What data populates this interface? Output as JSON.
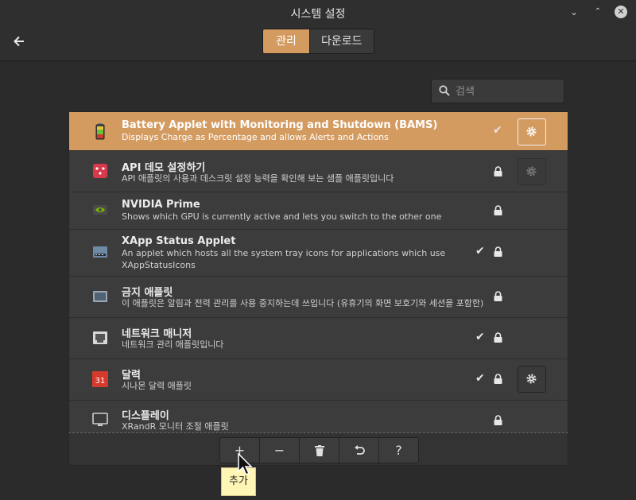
{
  "window": {
    "title": "시스템 설정"
  },
  "window_controls": {
    "minimize": "⌄",
    "maximize": "⌃",
    "close": "✕"
  },
  "header": {
    "back_icon": "back-arrow-icon",
    "tabs": [
      {
        "label": "관리",
        "active": true
      },
      {
        "label": "다운로드",
        "active": false
      }
    ]
  },
  "search": {
    "placeholder": "검색",
    "value": ""
  },
  "applets": [
    {
      "name": "Battery  Applet with Monitoring and Shutdown (BAMS)",
      "desc": "Displays Charge as Percentage and allows Alerts and Actions",
      "icon": "battery-icon",
      "enabled": true,
      "locked": false,
      "configurable": true,
      "selected": true
    },
    {
      "name": "API 데모 설정하기",
      "desc": "API 애플릿의 사용과 데스크릿 설정 능력을 확인해 보는 샘플 애플릿입니다",
      "icon": "api-demo-icon",
      "enabled": false,
      "locked": true,
      "configurable": true,
      "selected": false
    },
    {
      "name": "NVIDIA Prime",
      "desc": "Shows which GPU is currently active and lets you switch to the other one",
      "icon": "nvidia-icon",
      "enabled": false,
      "locked": true,
      "configurable": false,
      "selected": false
    },
    {
      "name": "XApp Status Applet",
      "desc": "An applet which hosts all the system tray icons for applications which use",
      "desc2": "XAppStatusIcons",
      "icon": "status-tray-icon",
      "enabled": true,
      "locked": true,
      "configurable": false,
      "selected": false
    },
    {
      "name": "금지 애플릿",
      "desc": "이 애플릿은 알림과 전력 관리를 사용 중지하는데 쓰입니다 (유휴기의 화면 보호기와 세션을 포함한)",
      "icon": "inhibit-icon",
      "enabled": false,
      "locked": true,
      "configurable": false,
      "selected": false
    },
    {
      "name": "네트워크 매니저",
      "desc": "네트워크 관리 애플릿입니다",
      "icon": "network-icon",
      "enabled": true,
      "locked": true,
      "configurable": false,
      "selected": false
    },
    {
      "name": "달력",
      "desc": "시나몬 달력 애플릿",
      "icon": "calendar-icon",
      "calendar_day": "31",
      "enabled": true,
      "locked": true,
      "configurable": true,
      "selected": false
    },
    {
      "name": "디스플레이",
      "desc": "XRandR 모니터 조절 애플릿",
      "icon": "display-icon",
      "enabled": false,
      "locked": true,
      "configurable": false,
      "selected": false
    }
  ],
  "toolbar": {
    "buttons": [
      {
        "label": "+",
        "icon": "add-icon"
      },
      {
        "label": "−",
        "icon": "remove-icon"
      },
      {
        "label": "",
        "icon": "trash-icon"
      },
      {
        "label": "",
        "icon": "undo-icon"
      },
      {
        "label": "?",
        "icon": "help-icon"
      }
    ],
    "tooltip": "추가"
  },
  "colors": {
    "accent": "#d49b61",
    "background": "#2b2b2b",
    "list_bg": "#3c3c3c"
  }
}
